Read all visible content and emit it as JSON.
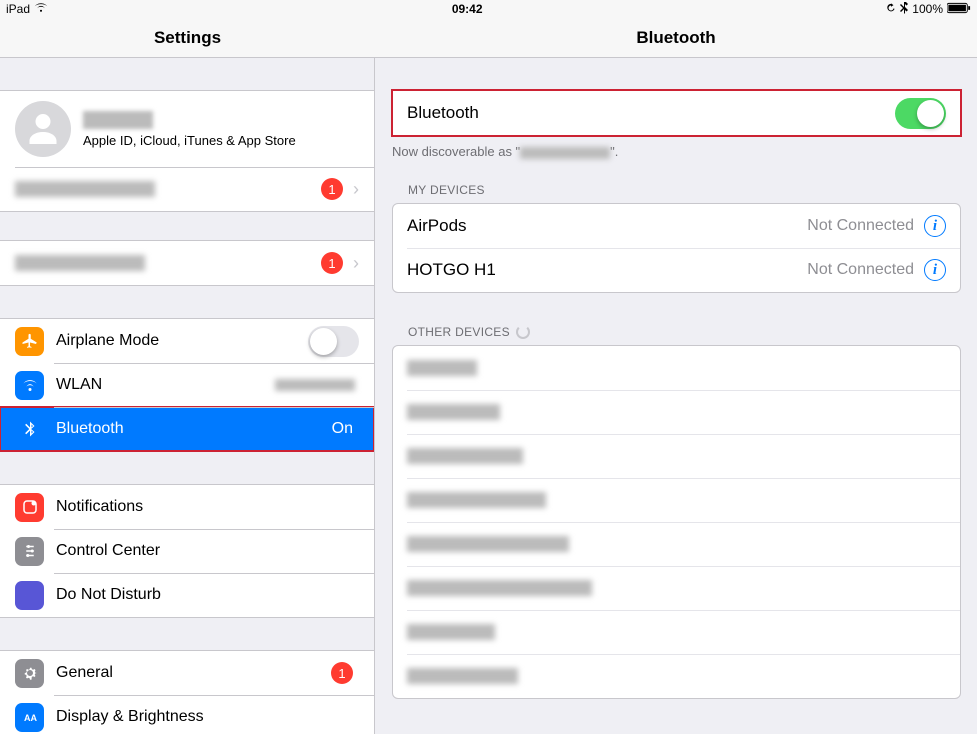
{
  "status": {
    "device": "iPad",
    "time": "09:42",
    "battery_pct": "100%"
  },
  "titles": {
    "left": "Settings",
    "right": "Bluetooth"
  },
  "sidebar": {
    "appleid_sub": "Apple ID, iCloud, iTunes & App Store",
    "appleid_badge": "1",
    "row2_badge": "1",
    "items": {
      "airplane": "Airplane Mode",
      "wlan": "WLAN",
      "bluetooth": "Bluetooth",
      "bluetooth_detail": "On",
      "notif": "Notifications",
      "cc": "Control Center",
      "dnd": "Do Not Disturb",
      "general": "General",
      "general_badge": "1",
      "display": "Display & Brightness"
    }
  },
  "detail": {
    "toggle_label": "Bluetooth",
    "toggle_on": true,
    "discover_prefix": "Now discoverable as \"",
    "discover_suffix": "\".",
    "section_my": "MY DEVICES",
    "my_devices": [
      {
        "name": "AirPods",
        "status": "Not Connected"
      },
      {
        "name": "HOTGO H1",
        "status": "Not Connected"
      }
    ],
    "section_other": "OTHER DEVICES",
    "other_count": 8
  }
}
